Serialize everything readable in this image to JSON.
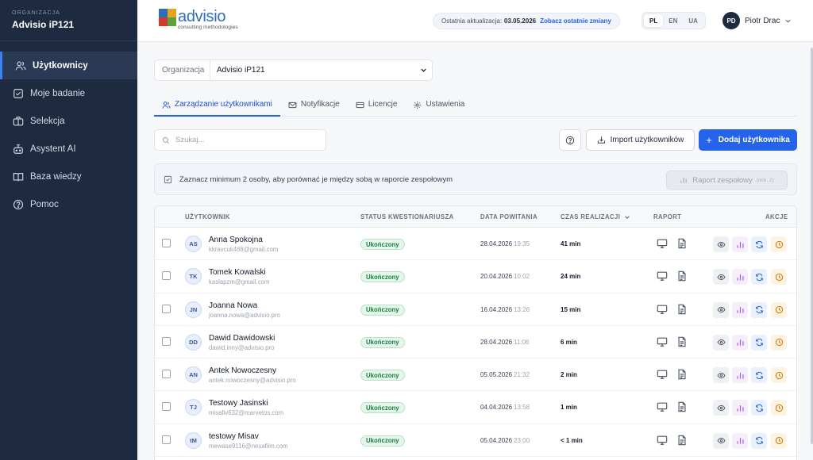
{
  "sidebar": {
    "org_caption": "ORGANIZACJA",
    "org_name": "Advisio iP121",
    "items": [
      {
        "label": "Użytkownicy",
        "icon": "users-icon",
        "active": true
      },
      {
        "label": "Moje badanie",
        "icon": "checkbox-icon"
      },
      {
        "label": "Selekcja",
        "icon": "briefcase-icon"
      },
      {
        "label": "Asystent AI",
        "icon": "robot-icon"
      },
      {
        "label": "Baza wiedzy",
        "icon": "book-icon"
      },
      {
        "label": "Pomoc",
        "icon": "help-circle-icon"
      }
    ]
  },
  "topbar": {
    "logo_name": "advisio",
    "logo_sub": "consulting methodologies",
    "update_label": "Ostatnia aktualizacja:",
    "update_date": "03.05.2026",
    "update_link": "Zobacz ostatnie zmiany",
    "languages": [
      "PL",
      "EN",
      "UA"
    ],
    "active_language": "PL",
    "user_initials": "PD",
    "user_name": "Piotr Drac"
  },
  "org_select": {
    "label": "Organizacja",
    "value": "Advisio iP121"
  },
  "tabs": [
    {
      "label": "Zarządzanie użytkownikami",
      "active": true
    },
    {
      "label": "Notyfikacje"
    },
    {
      "label": "Licencje"
    },
    {
      "label": "Ustawienia"
    }
  ],
  "toolbar": {
    "search_placeholder": "Szukaj...",
    "import_label": "Import użytkowników",
    "add_label": "Dodaj użytkownika"
  },
  "banner": {
    "text": "Zaznacz minimum 2 osoby, aby porównać je między sobą w raporcie zespołowym",
    "team_report_label": "Raport zespołowy",
    "team_report_hint": "(min. 2)"
  },
  "table": {
    "headers": {
      "user": "UŻYTKOWNIK",
      "status": "STATUS KWESTIONARIUSZA",
      "date": "DATA POWITANIA",
      "time": "CZAS REALIZACJI",
      "report": "RAPORT",
      "actions": "AKCJE"
    },
    "rows": [
      {
        "initials": "AS",
        "name": "Anna Spokojna",
        "email": "kkravcuk468@gmail.com",
        "status": "Ukończony",
        "date": "28.04.2026",
        "time": "19:35",
        "duration": "41 min"
      },
      {
        "initials": "TK",
        "name": "Tomek Kowalski",
        "email": "kaslapzm@gmail.com",
        "status": "Ukończony",
        "date": "20.04.2026",
        "time": "10:02",
        "duration": "24 min"
      },
      {
        "initials": "JN",
        "name": "Joanna Nowa",
        "email": "joanna.nowa@advisio.pro",
        "status": "Ukończony",
        "date": "16.04.2026",
        "time": "13:26",
        "duration": "15 min"
      },
      {
        "initials": "DD",
        "name": "Dawid Dawidowski",
        "email": "dawid.inny@advisio.pro",
        "status": "Ukończony",
        "date": "28.04.2026",
        "time": "11:06",
        "duration": "6 min"
      },
      {
        "initials": "AN",
        "name": "Antek Nowoczesny",
        "email": "antek.nowoczesny@advisio.pro",
        "status": "Ukończony",
        "date": "05.05.2026",
        "time": "21:32",
        "duration": "2 min"
      },
      {
        "initials": "TJ",
        "name": "Testowy Jasinski",
        "email": "misafiv632@marvetos.com",
        "status": "Ukończony",
        "date": "04.04.2026",
        "time": "13:58",
        "duration": "1 min"
      },
      {
        "initials": "tM",
        "name": "testowy Misav",
        "email": "mewase9116@nexafilm.com",
        "status": "Ukończony",
        "date": "05.04.2026",
        "time": "23:00",
        "duration": "< 1 min"
      }
    ]
  },
  "colors": {
    "sidebar_bg": "#1d2a3f",
    "primary": "#2563eb",
    "success": "#15803d"
  }
}
